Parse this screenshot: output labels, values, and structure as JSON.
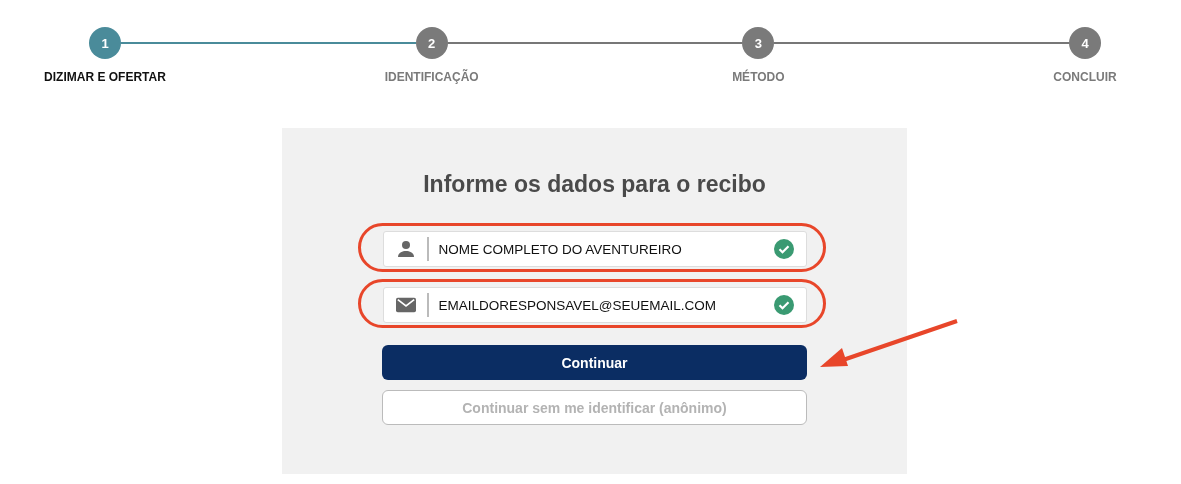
{
  "steps": [
    {
      "number": "1",
      "label": "DIZIMAR E OFERTAR",
      "selected": true
    },
    {
      "number": "2",
      "label": "IDENTIFICAÇÃO",
      "selected": false
    },
    {
      "number": "3",
      "label": "MÉTODO",
      "selected": false
    },
    {
      "number": "4",
      "label": "CONCLUIR",
      "selected": false
    }
  ],
  "form": {
    "title": "Informe os dados para o recibo",
    "fields": [
      {
        "kind": "person",
        "value": "NOME COMPLETO DO AVENTUREIRO",
        "valid": true,
        "highlighted": true
      },
      {
        "kind": "email",
        "value": "EMAILDORESPONSAVEL@SEUEMAIL.COM",
        "valid": true,
        "highlighted": true
      }
    ],
    "buttons": [
      {
        "kind": "primary",
        "label": "Continuar"
      },
      {
        "kind": "secondary",
        "label": "Continuar sem me identificar (anônimo)"
      }
    ]
  }
}
